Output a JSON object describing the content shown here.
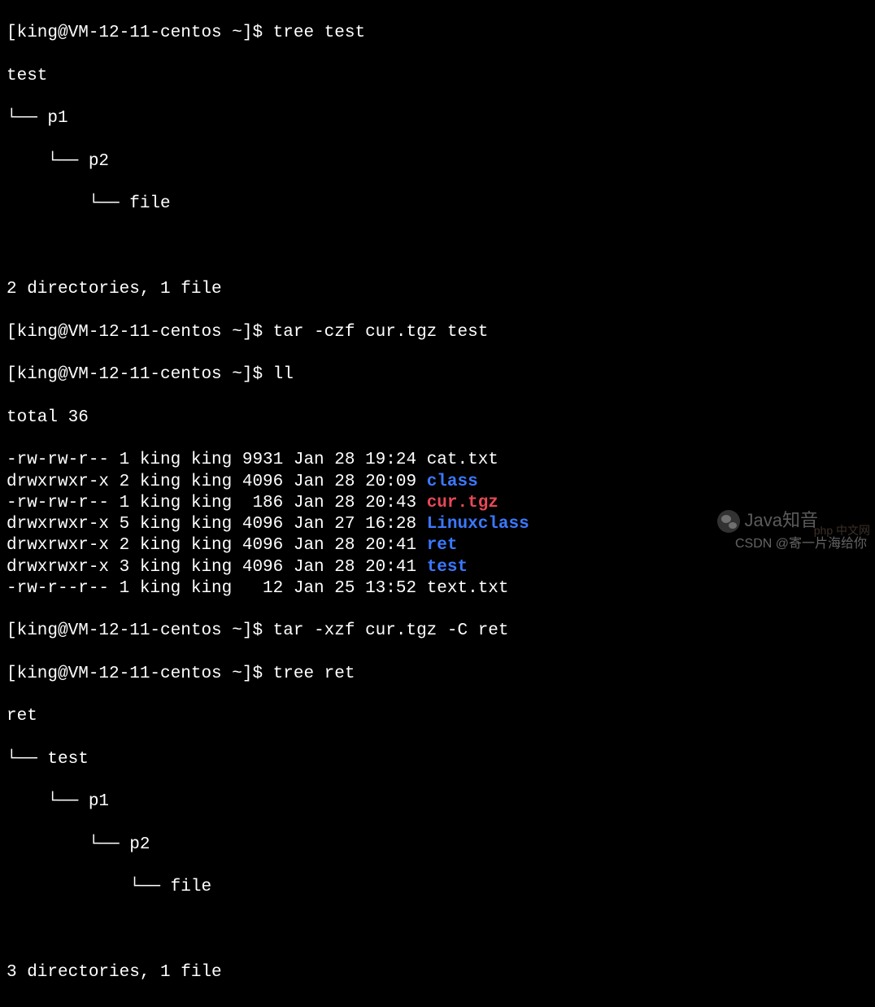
{
  "prompt": "[king@VM-12-11-centos ~]$ ",
  "commands": {
    "tree_test": "tree test",
    "tar_create": "tar -czf cur.tgz test",
    "ll": "ll",
    "tar_extract": "tar -xzf cur.tgz -C ret",
    "tree_ret": "tree ret"
  },
  "tree1": {
    "root": "test",
    "l1": "└── p1",
    "l2": "    └── p2",
    "l3": "        └── file",
    "summary": "2 directories, 1 file"
  },
  "ll": {
    "total": "total 36",
    "rows": [
      {
        "perm": "-rw-rw-r--",
        "links": "1",
        "owner": "king",
        "group": "king",
        "size": "9931",
        "date": "Jan 28 19:24",
        "name": "cat.txt",
        "cls": ""
      },
      {
        "perm": "drwxrwxr-x",
        "links": "2",
        "owner": "king",
        "group": "king",
        "size": "4096",
        "date": "Jan 28 20:09",
        "name": "class",
        "cls": "dir"
      },
      {
        "perm": "-rw-rw-r--",
        "links": "1",
        "owner": "king",
        "group": "king",
        "size": " 186",
        "date": "Jan 28 20:43",
        "name": "cur.tgz",
        "cls": "archive"
      },
      {
        "perm": "drwxrwxr-x",
        "links": "5",
        "owner": "king",
        "group": "king",
        "size": "4096",
        "date": "Jan 27 16:28",
        "name": "Linuxclass",
        "cls": "dir"
      },
      {
        "perm": "drwxrwxr-x",
        "links": "2",
        "owner": "king",
        "group": "king",
        "size": "4096",
        "date": "Jan 28 20:41",
        "name": "ret",
        "cls": "dir"
      },
      {
        "perm": "drwxrwxr-x",
        "links": "3",
        "owner": "king",
        "group": "king",
        "size": "4096",
        "date": "Jan 28 20:41",
        "name": "test",
        "cls": "dir"
      },
      {
        "perm": "-rw-r--r--",
        "links": "1",
        "owner": "king",
        "group": "king",
        "size": "  12",
        "date": "Jan 25 13:52",
        "name": "text.txt",
        "cls": ""
      }
    ]
  },
  "tree2": {
    "root": "ret",
    "l1": "└── test",
    "l2": "    └── p1",
    "l3": "        └── p2",
    "l4": "            └── file",
    "summary": "3 directories, 1 file"
  },
  "watermarks": {
    "java": "Java知音",
    "csdn": "CSDN @寄一片海给你",
    "php": "php 中文网"
  }
}
